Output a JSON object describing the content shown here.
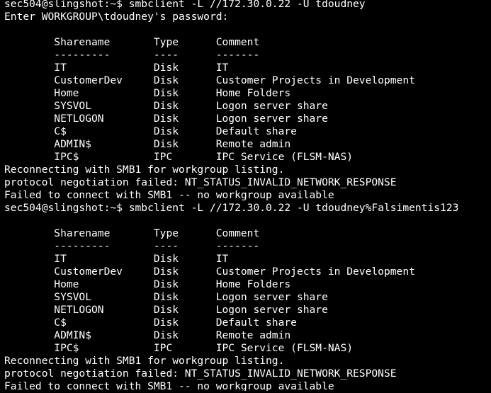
{
  "terminal": {
    "background": "#000000",
    "foreground": "#ffffff",
    "lines": [
      "sec504@slingshot:~$ smbclient -L //172.30.0.22 -U tdoudney",
      "Enter WORKGROUP\\tdoudney's password:",
      "",
      "        Sharename       Type      Comment",
      "        ---------       ----      -------",
      "        IT              Disk      IT",
      "        CustomerDev     Disk      Customer Projects in Development",
      "        Home            Disk      Home Folders",
      "        SYSVOL          Disk      Logon server share",
      "        NETLOGON        Disk      Logon server share",
      "        C$              Disk      Default share",
      "        ADMIN$          Disk      Remote admin",
      "        IPC$            IPC       IPC Service (FLSM-NAS)",
      "Reconnecting with SMB1 for workgroup listing.",
      "protocol negotiation failed: NT_STATUS_INVALID_NETWORK_RESPONSE",
      "Failed to connect with SMB1 -- no workgroup available",
      "sec504@slingshot:~$ smbclient -L //172.30.0.22 -U tdoudney%Falsimentis123",
      "",
      "        Sharename       Type      Comment",
      "        ---------       ----      -------",
      "        IT              Disk      IT",
      "        CustomerDev     Disk      Customer Projects in Development",
      "        Home            Disk      Home Folders",
      "        SYSVOL          Disk      Logon server share",
      "        NETLOGON        Disk      Logon server share",
      "        C$              Disk      Default share",
      "        ADMIN$          Disk      Remote admin",
      "        IPC$            IPC       IPC Service (FLSM-NAS)",
      "Reconnecting with SMB1 for workgroup listing.",
      "protocol negotiation failed: NT_STATUS_INVALID_NETWORK_RESPONSE",
      "Failed to connect with SMB1 -- no workgroup available"
    ]
  }
}
